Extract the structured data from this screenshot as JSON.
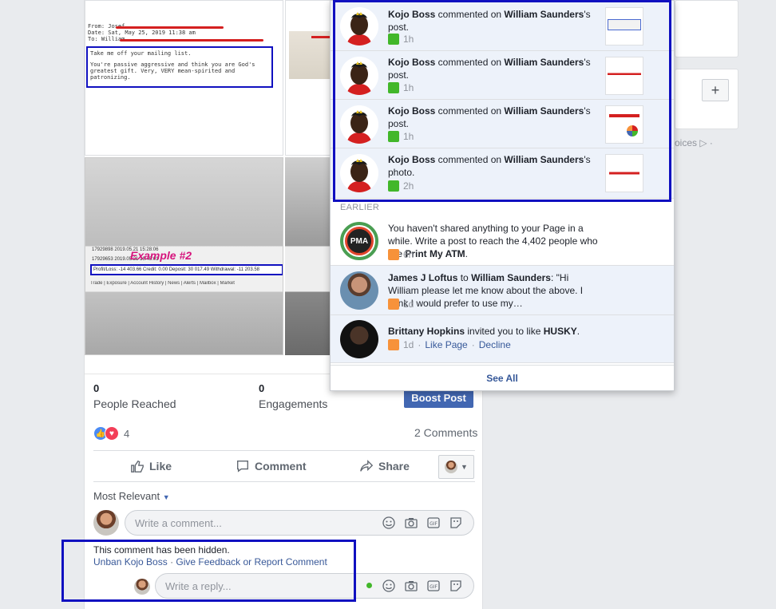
{
  "post": {
    "email_image": {
      "from": "From: Josef",
      "date": "Date: Sat, May 25, 2019 11:38 am",
      "to": "To: William",
      "body_1": "Take me off your mailing list.",
      "body_2": "You're passive aggressive and think you are God's greatest gift. Very, VERY mean-spirited and patronizing."
    },
    "example_image": {
      "title": "Example #2",
      "row_1": "17929898    2019.05.21 15:28:06",
      "row_2": "17929653    2019.05.21 16:45:01",
      "bar": "Profit/Loss: -14 403.66  Credit: 0.00  Deposit: 30 017.49  Withdrawal: -11 203.58",
      "tabs": "Trade | Exposure | Account History | News | Alerts | Mailbox | Market"
    },
    "stats": {
      "reached_count": "0",
      "reached_label": "People Reached",
      "engagements_count": "0",
      "engagements_label": "Engagements",
      "boost_label": "Boost Post"
    },
    "reactions_count": "4",
    "comments_count": "2 Comments",
    "actions": {
      "like": "Like",
      "comment": "Comment",
      "share": "Share"
    },
    "most_relevant": "Most Relevant",
    "comment_placeholder": "Write a comment...",
    "hidden_comment": {
      "note": "This comment has been hidden.",
      "unban": "Unban Kojo Boss",
      "separator": " · ",
      "feedback": "Give Feedback or Report Comment"
    },
    "reply_placeholder": "Write a reply..."
  },
  "right_column": {
    "plus_label": "+",
    "adchoices": "oices ▷ ·"
  },
  "notifications": {
    "items": [
      {
        "actor": "Kojo Boss",
        "verb": " commented on ",
        "target": "William Saunders",
        "suffix": "'s post.",
        "time": "1h"
      },
      {
        "actor": "Kojo Boss",
        "verb": " commented on ",
        "target": "William Saunders",
        "suffix": "'s post.",
        "time": "1h"
      },
      {
        "actor": "Kojo Boss",
        "verb": " commented on ",
        "target": "William Saunders",
        "suffix": "'s post.",
        "time": "1h"
      },
      {
        "actor": "Kojo Boss",
        "verb": " commented on ",
        "target": "William Saunders",
        "suffix": "'s photo.",
        "time": "2h"
      }
    ],
    "earlier_label": "EARLIER",
    "earlier": [
      {
        "text_pre": "You haven't shared anything to your Page in a while. Write a post to reach the 4,402 people who like ",
        "page": "Print My ATM",
        "text_post": ".",
        "time": "6h",
        "avatar_text": "PMA"
      },
      {
        "actor": "James J Loftus",
        "verb": " to ",
        "target": "William Saunders",
        "text": ": \"Hi William please let me know about the above. I think I would prefer to use my…",
        "time": "1d"
      },
      {
        "actor": "Brittany Hopkins",
        "verb": " invited you to like ",
        "target": "HUSKY",
        "suffix": ".",
        "time": "1d",
        "like_page": "Like Page",
        "decline": "Decline",
        "sep": " · "
      }
    ],
    "see_all": "See All"
  },
  "colors": {
    "accent": "#4267b2",
    "annotation_box": "#1010c0",
    "notification_bg": "#edf2fa"
  }
}
